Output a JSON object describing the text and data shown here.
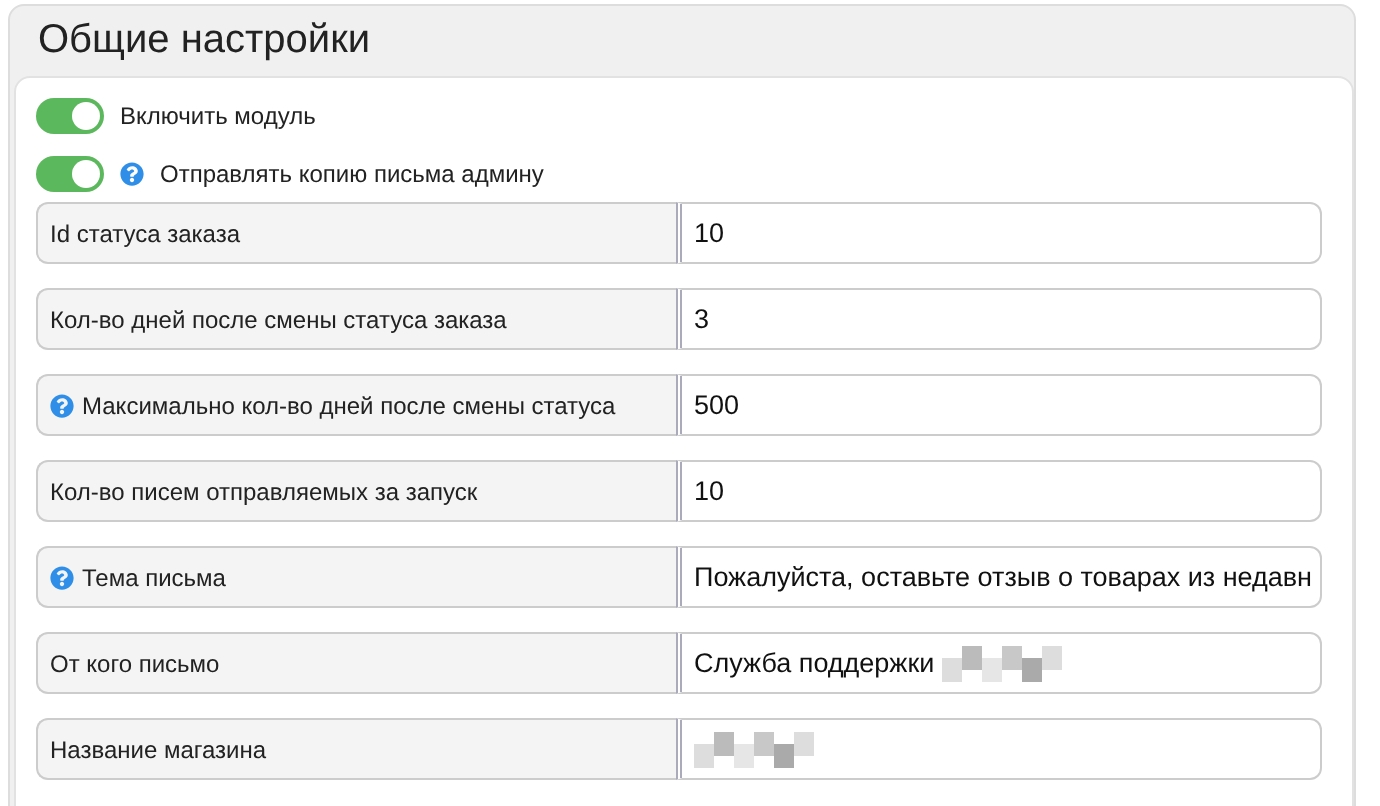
{
  "title": "Общие настройки",
  "toggles": [
    {
      "label": "Включить модуль",
      "on": true,
      "help": false
    },
    {
      "label": "Отправлять копию письма админу",
      "on": true,
      "help": true
    }
  ],
  "fields": [
    {
      "label": "Id статуса заказа",
      "value": "10",
      "help": false,
      "redacted": false
    },
    {
      "label": "Кол-во дней после смены статуса заказа",
      "value": "3",
      "help": false,
      "redacted": false
    },
    {
      "label": "Максимально кол-во дней после смены статуса",
      "value": "500",
      "help": true,
      "redacted": false
    },
    {
      "label": "Кол-во писем отправляемых за запуск",
      "value": "10",
      "help": false,
      "redacted": false
    },
    {
      "label": "Тема письма",
      "value": "Пожалуйста, оставьте отзыв о товарах из недавн",
      "help": true,
      "redacted": false
    },
    {
      "label": "От кого письмо",
      "value": "Служба поддержки",
      "help": false,
      "redacted": true
    },
    {
      "label": "Название магазина",
      "help": false,
      "redacted": true
    }
  ]
}
